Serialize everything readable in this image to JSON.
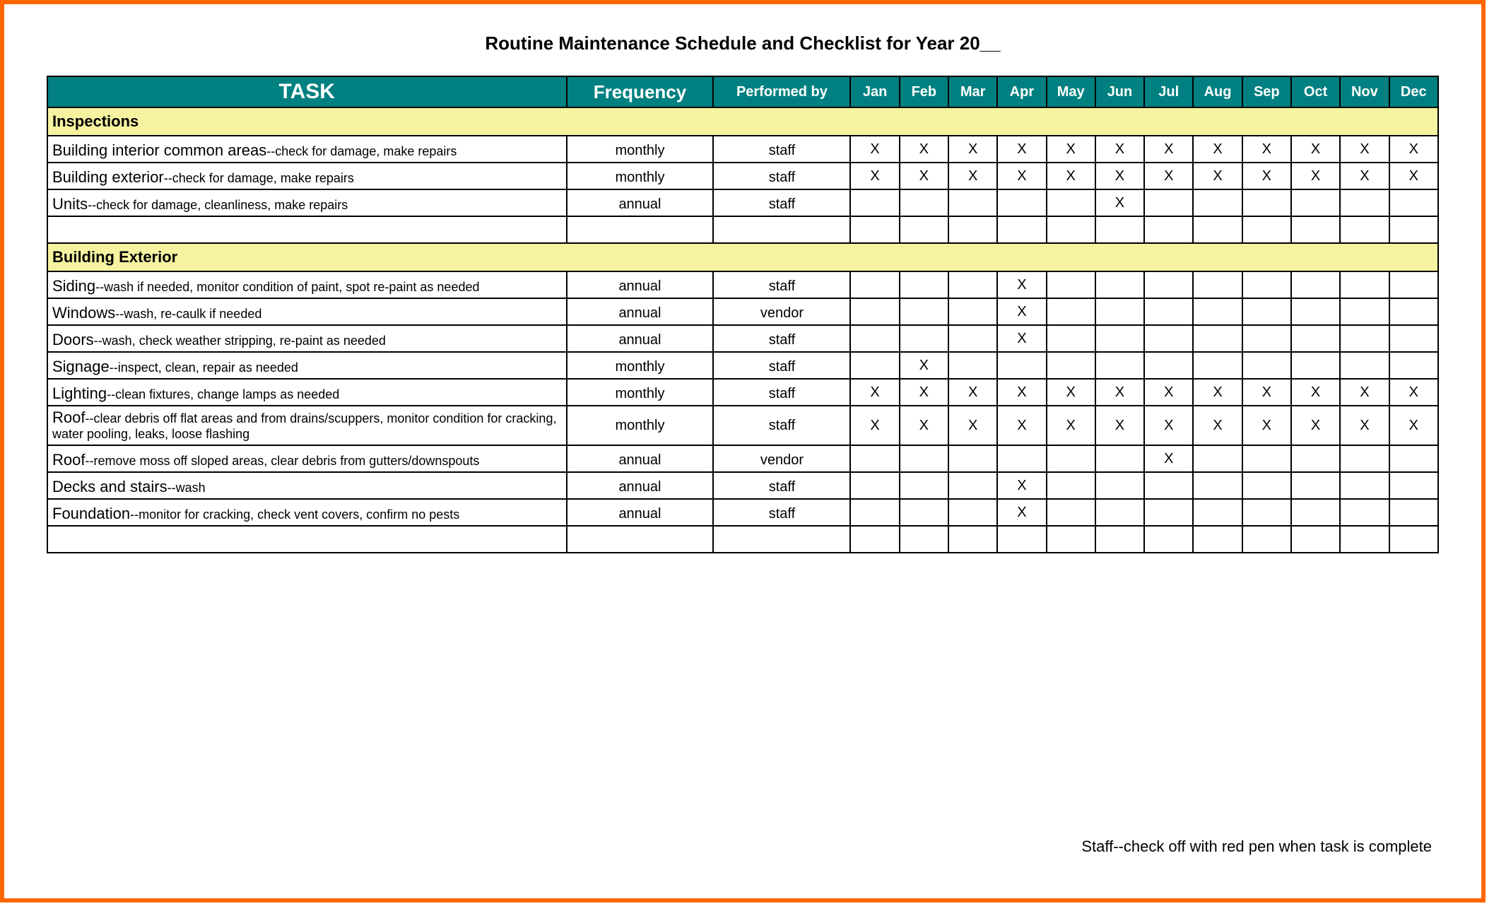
{
  "title": "Routine Maintenance Schedule and Checklist for Year 20__",
  "headers": {
    "task": "TASK",
    "frequency": "Frequency",
    "performed_by": "Performed by",
    "months": [
      "Jan",
      "Feb",
      "Mar",
      "Apr",
      "May",
      "Jun",
      "Jul",
      "Aug",
      "Sep",
      "Oct",
      "Nov",
      "Dec"
    ]
  },
  "sections": [
    {
      "name": "Inspections",
      "rows": [
        {
          "task": "Building interior common areas",
          "desc": "--check for damage, make repairs",
          "frequency": "monthly",
          "performed_by": "staff",
          "months": [
            "X",
            "X",
            "X",
            "X",
            "X",
            "X",
            "X",
            "X",
            "X",
            "X",
            "X",
            "X"
          ]
        },
        {
          "task": "Building exterior",
          "desc": "--check for damage, make repairs",
          "frequency": "monthly",
          "performed_by": "staff",
          "months": [
            "X",
            "X",
            "X",
            "X",
            "X",
            "X",
            "X",
            "X",
            "X",
            "X",
            "X",
            "X"
          ]
        },
        {
          "task": "Units",
          "desc": "--check for damage, cleanliness, make repairs",
          "frequency": "annual",
          "performed_by": "staff",
          "months": [
            "",
            "",
            "",
            "",
            "",
            "X",
            "",
            "",
            "",
            "",
            "",
            ""
          ]
        },
        {
          "task": "",
          "desc": "",
          "frequency": "",
          "performed_by": "",
          "months": [
            "",
            "",
            "",
            "",
            "",
            "",
            "",
            "",
            "",
            "",
            "",
            ""
          ]
        }
      ]
    },
    {
      "name": "Building Exterior",
      "rows": [
        {
          "task": "Siding",
          "desc": "--wash if needed, monitor condition of paint, spot re-paint as needed",
          "frequency": "annual",
          "performed_by": "staff",
          "months": [
            "",
            "",
            "",
            "X",
            "",
            "",
            "",
            "",
            "",
            "",
            "",
            ""
          ]
        },
        {
          "task": "Windows",
          "desc": "--wash, re-caulk if needed",
          "frequency": "annual",
          "performed_by": "vendor",
          "months": [
            "",
            "",
            "",
            "X",
            "",
            "",
            "",
            "",
            "",
            "",
            "",
            ""
          ]
        },
        {
          "task": "Doors",
          "desc": "--wash, check weather stripping, re-paint as needed",
          "frequency": "annual",
          "performed_by": "staff",
          "months": [
            "",
            "",
            "",
            "X",
            "",
            "",
            "",
            "",
            "",
            "",
            "",
            ""
          ]
        },
        {
          "task": "Signage",
          "desc": "--inspect, clean, repair as needed",
          "frequency": "monthly",
          "performed_by": "staff",
          "months": [
            "",
            "X",
            "",
            "",
            "",
            "",
            "",
            "",
            "",
            "",
            "",
            ""
          ]
        },
        {
          "task": "Lighting",
          "desc": "--clean fixtures, change lamps as needed",
          "frequency": "monthly",
          "performed_by": "staff",
          "months": [
            "X",
            "X",
            "X",
            "X",
            "X",
            "X",
            "X",
            "X",
            "X",
            "X",
            "X",
            "X"
          ]
        },
        {
          "task": "Roof",
          "desc": "--clear debris off flat areas and from drains/scuppers, monitor condition for cracking, water pooling, leaks, loose flashing",
          "frequency": "monthly",
          "performed_by": "staff",
          "months": [
            "X",
            "X",
            "X",
            "X",
            "X",
            "X",
            "X",
            "X",
            "X",
            "X",
            "X",
            "X"
          ],
          "tall": true
        },
        {
          "task": "Roof",
          "desc": "--remove moss off sloped areas, clear debris from gutters/downspouts",
          "frequency": "annual",
          "performed_by": "vendor",
          "months": [
            "",
            "",
            "",
            "",
            "",
            "",
            "X",
            "",
            "",
            "",
            "",
            ""
          ]
        },
        {
          "task": "Decks and stairs",
          "desc": "--wash",
          "frequency": "annual",
          "performed_by": "staff",
          "months": [
            "",
            "",
            "",
            "X",
            "",
            "",
            "",
            "",
            "",
            "",
            "",
            ""
          ]
        },
        {
          "task": "Foundation",
          "desc": "--monitor for cracking, check vent covers, confirm no pests",
          "frequency": "annual",
          "performed_by": "staff",
          "months": [
            "",
            "",
            "",
            "X",
            "",
            "",
            "",
            "",
            "",
            "",
            "",
            ""
          ]
        },
        {
          "task": "",
          "desc": "",
          "frequency": "",
          "performed_by": "",
          "months": [
            "",
            "",
            "",
            "",
            "",
            "",
            "",
            "",
            "",
            "",
            "",
            ""
          ]
        }
      ]
    }
  ],
  "footnote": "Staff--check off with red pen when task is complete"
}
